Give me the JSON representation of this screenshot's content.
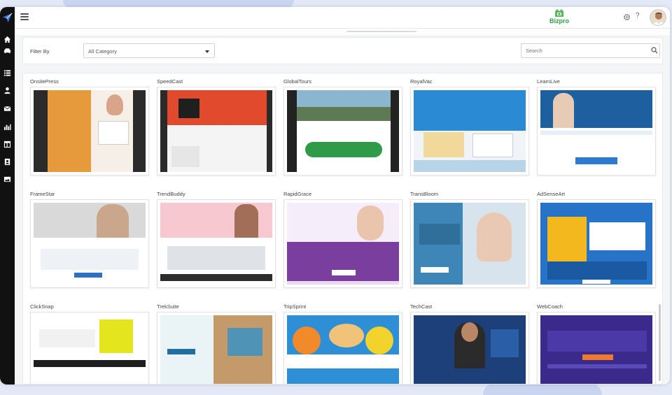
{
  "app": {
    "brand_name": "Bizpro"
  },
  "topbar": {
    "help_label": "?"
  },
  "filter": {
    "label": "Filter By",
    "category_selected": "All Category",
    "search_placeholder": "Search"
  },
  "templates": [
    {
      "name": "OnsitePress"
    },
    {
      "name": "SpeedCast"
    },
    {
      "name": "GlobalTours"
    },
    {
      "name": "RoyalVac"
    },
    {
      "name": "LearnLive"
    },
    {
      "name": "FrameStar"
    },
    {
      "name": "TrendBuddy"
    },
    {
      "name": "RapidGrace"
    },
    {
      "name": "TransBloom"
    },
    {
      "name": "AdSenseArt"
    },
    {
      "name": "ClickSnap"
    },
    {
      "name": "TrekSuite"
    },
    {
      "name": "TripSprint"
    },
    {
      "name": "TechCast"
    },
    {
      "name": "WebCoach"
    }
  ],
  "sidebar_icons": [
    "home-icon",
    "car-icon",
    "list-icon",
    "user-icon",
    "mail-icon",
    "chart-icon",
    "layout-icon",
    "contact-icon",
    "image-icon"
  ],
  "colors": {
    "sidebar_bg": "#111111",
    "brand_green": "#2e9e3f",
    "page_bg": "#e3e9f6"
  }
}
